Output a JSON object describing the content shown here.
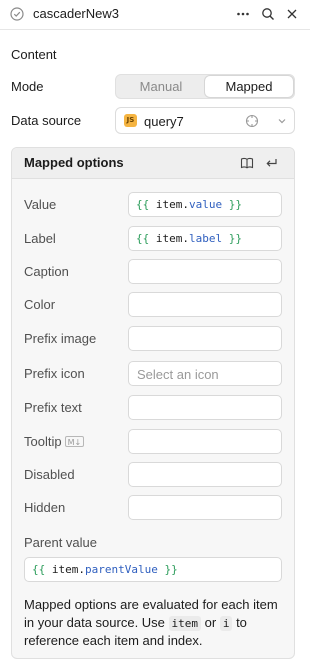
{
  "header": {
    "title": "cascaderNew3",
    "icons": [
      "check-circle-icon",
      "more-icon",
      "search-icon",
      "close-icon"
    ]
  },
  "content": {
    "section_title": "Content",
    "mode_label": "Mode",
    "mode_options": [
      "Manual",
      "Mapped"
    ],
    "mode_selected": "Mapped",
    "data_source_label": "Data source",
    "data_source_value": "query7",
    "data_source_badge": "JS"
  },
  "mapped": {
    "title": "Mapped options",
    "fields": {
      "value": {
        "label": "Value",
        "code_open": "{{",
        "ident": "item.",
        "prop": "value",
        "code_close": "}}"
      },
      "label": {
        "label": "Label",
        "code_open": "{{",
        "ident": "item.",
        "prop": "label",
        "code_close": "}}"
      },
      "caption": {
        "label": "Caption"
      },
      "color": {
        "label": "Color"
      },
      "prefix_image": {
        "label": "Prefix image"
      },
      "prefix_icon": {
        "label": "Prefix icon",
        "placeholder": "Select an icon"
      },
      "prefix_text": {
        "label": "Prefix text"
      },
      "tooltip": {
        "label": "Tooltip",
        "badge": "M↓"
      },
      "disabled": {
        "label": "Disabled"
      },
      "hidden": {
        "label": "Hidden"
      },
      "parent_value": {
        "label": "Parent value",
        "code_open": "{{",
        "ident": "item.",
        "prop": "parentValue",
        "code_close": "}}"
      }
    },
    "note": {
      "part1": "Mapped options are evaluated for each item in your data source. Use ",
      "code1": "item",
      "part2": " or ",
      "code2": "i",
      "part3": " to reference each item and index."
    }
  }
}
